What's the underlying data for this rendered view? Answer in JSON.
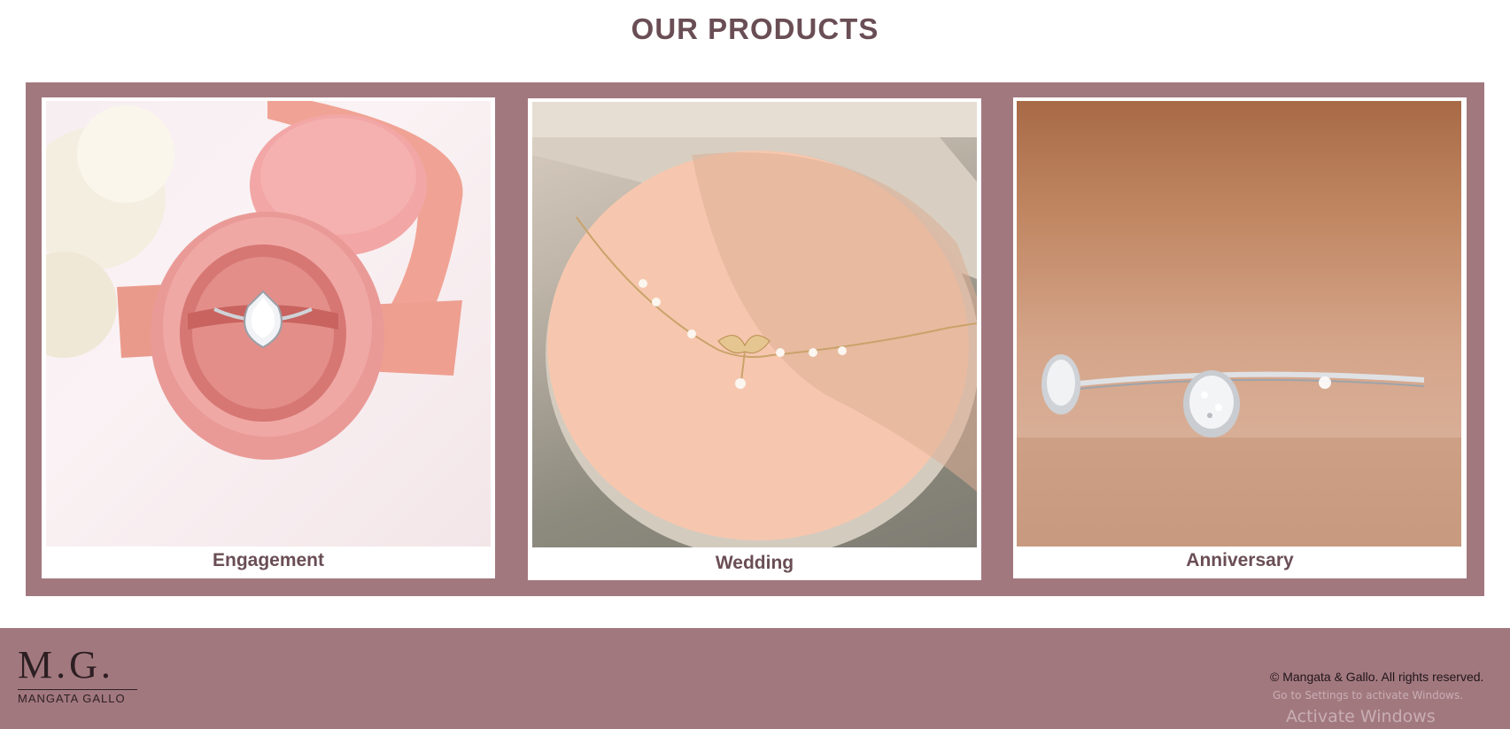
{
  "section": {
    "title": "OUR PRODUCTS"
  },
  "products": [
    {
      "label": "Engagement"
    },
    {
      "label": "Wedding"
    },
    {
      "label": "Anniversary"
    }
  ],
  "footer": {
    "logo_mark": "M.G.",
    "logo_name": "MANGATA GALLO",
    "copyright": "© Mangata & Gallo. All rights reserved."
  },
  "os_watermark": {
    "title": "Activate Windows",
    "subtitle": "Go to Settings to activate Windows."
  },
  "colors": {
    "accent": "#a2787f",
    "heading": "#6a4e55",
    "background": "#ffffff"
  }
}
